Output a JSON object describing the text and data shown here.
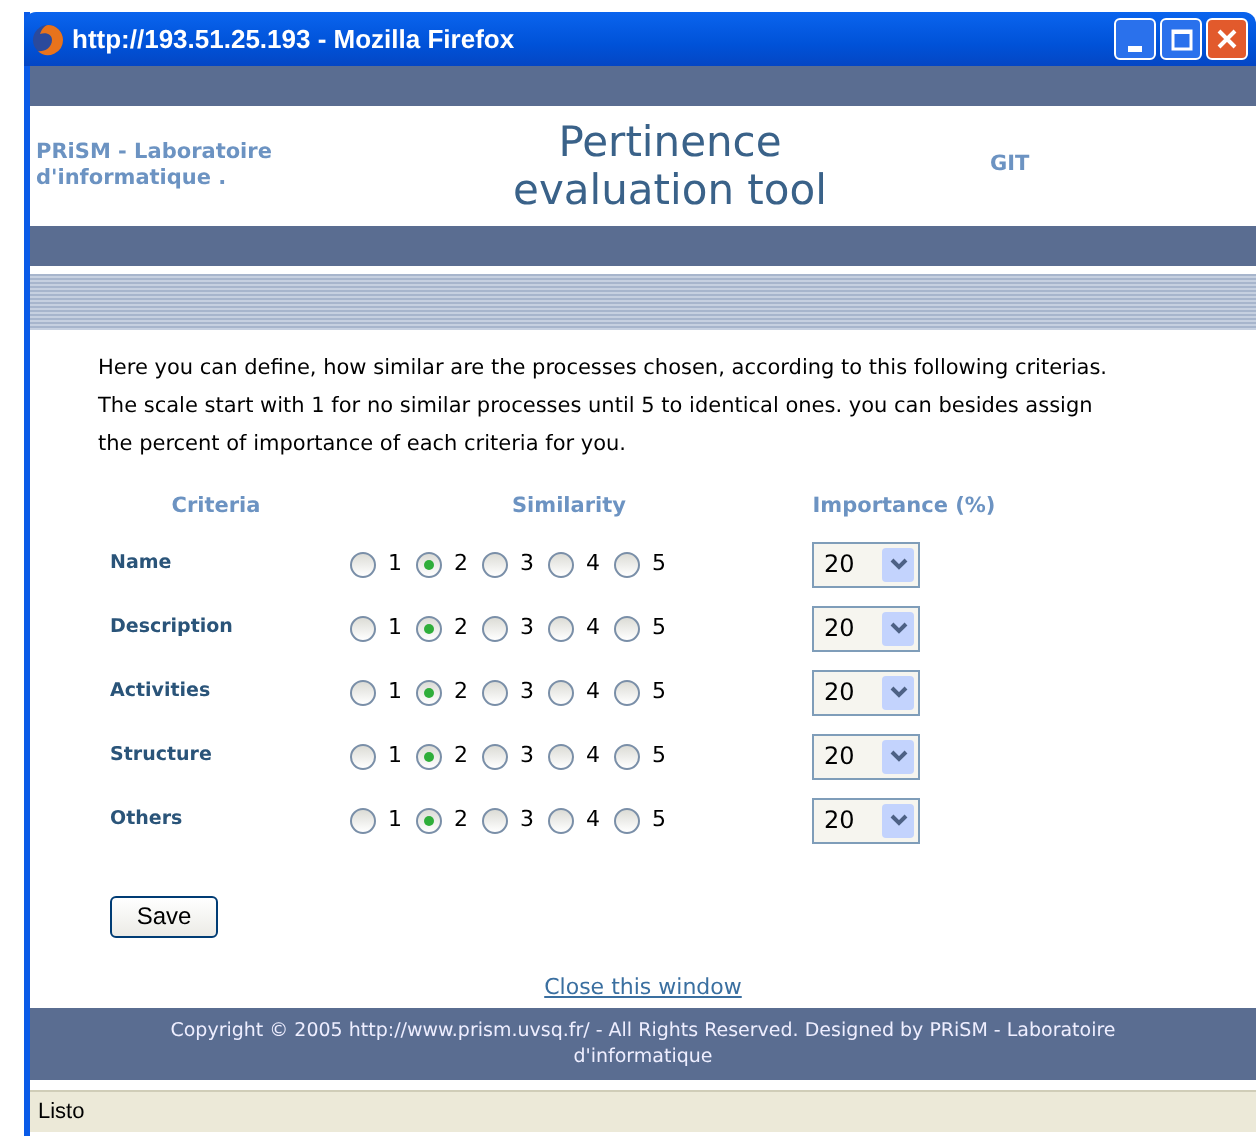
{
  "window": {
    "title": "http://193.51.25.193 - Mozilla Firefox"
  },
  "header": {
    "left": "PRiSM - Laboratoire d'informatique .",
    "title": "Pertinence evaluation tool",
    "right": "GIT"
  },
  "intro": "Here you can define, how similar are the processes chosen, according to this following criterias. The scale start with 1 for no similar processes until 5 to identical ones. you can besides assign the percent of importance of each criteria for you.",
  "columns": [
    "Criteria",
    "Similarity",
    "Importance (%)"
  ],
  "rows": [
    {
      "name": "Name",
      "options": [
        {
          "label": "1",
          "selected": false
        },
        {
          "label": "2",
          "selected": true
        },
        {
          "label": "3",
          "selected": false
        },
        {
          "label": "4",
          "selected": false
        },
        {
          "label": "5",
          "selected": false
        }
      ],
      "importance": "20"
    },
    {
      "name": "Description",
      "options": [
        {
          "label": "1",
          "selected": false
        },
        {
          "label": "2",
          "selected": true
        },
        {
          "label": "3",
          "selected": false
        },
        {
          "label": "4",
          "selected": false
        },
        {
          "label": "5",
          "selected": false
        }
      ],
      "importance": "20"
    },
    {
      "name": "Activities",
      "options": [
        {
          "label": "1",
          "selected": false
        },
        {
          "label": "2",
          "selected": true
        },
        {
          "label": "3",
          "selected": false
        },
        {
          "label": "4",
          "selected": false
        },
        {
          "label": "5",
          "selected": false
        }
      ],
      "importance": "20"
    },
    {
      "name": "Structure",
      "options": [
        {
          "label": "1",
          "selected": false
        },
        {
          "label": "2",
          "selected": true
        },
        {
          "label": "3",
          "selected": false
        },
        {
          "label": "4",
          "selected": false
        },
        {
          "label": "5",
          "selected": false
        }
      ],
      "importance": "20"
    },
    {
      "name": "Others",
      "options": [
        {
          "label": "1",
          "selected": false
        },
        {
          "label": "2",
          "selected": true
        },
        {
          "label": "3",
          "selected": false
        },
        {
          "label": "4",
          "selected": false
        },
        {
          "label": "5",
          "selected": false
        }
      ],
      "importance": "20"
    }
  ],
  "save_button": "Save",
  "close_link": "Close this window",
  "footer": "Copyright © 2005 http://www.prism.uvsq.fr/ - All Rights Reserved. Designed by PRiSM - Laboratoire d'informatique",
  "status_bar": "Listo"
}
